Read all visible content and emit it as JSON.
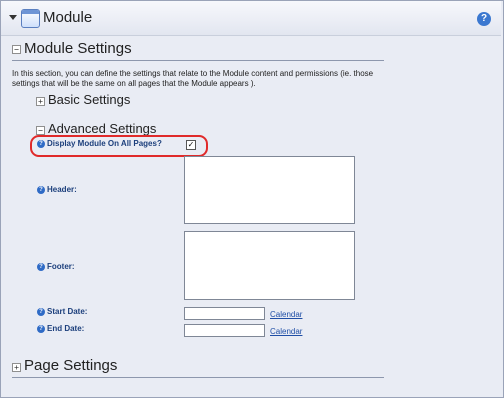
{
  "module": {
    "title": "Module",
    "help_symbol": "?"
  },
  "module_settings": {
    "title": "Module Settings",
    "toggle": "−",
    "description": "In this section, you can define the settings that relate to the Module content and permissions (ie. those settings that will be the same on all pages that the Module appears )."
  },
  "basic_settings": {
    "title": "Basic Settings",
    "toggle": "+"
  },
  "advanced_settings": {
    "title": "Advanced Settings",
    "toggle": "−",
    "display_all_pages_label": "Display Module On All Pages?",
    "display_all_pages_checked": true,
    "header_label": "Header:",
    "footer_label": "Footer:",
    "start_date_label": "Start Date:",
    "end_date_label": "End Date:",
    "calendar_link": "Calendar",
    "help_symbol": "?",
    "check_mark": "✓"
  },
  "page_settings": {
    "title": "Page Settings",
    "toggle": "+"
  }
}
